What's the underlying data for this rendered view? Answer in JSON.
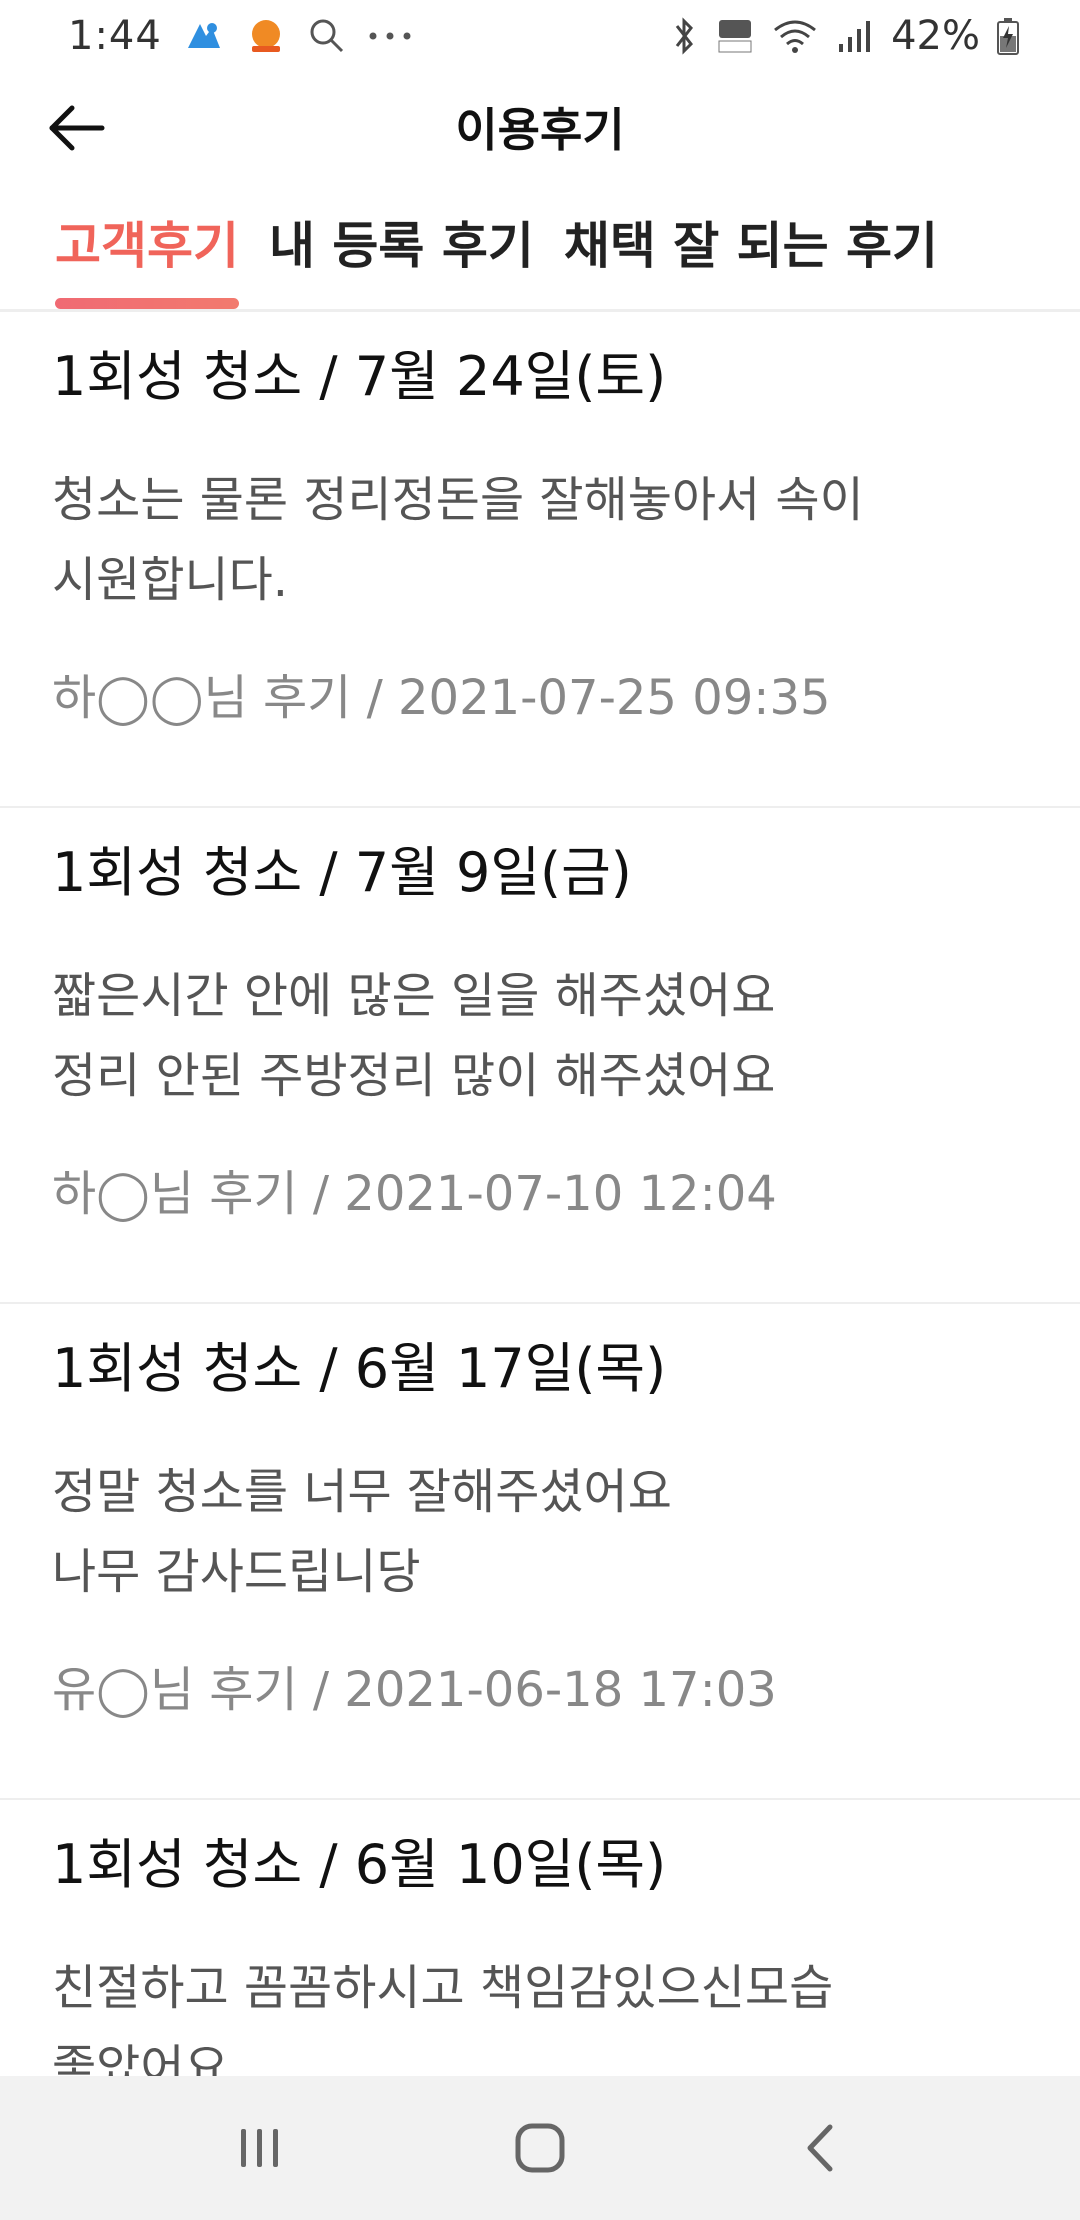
{
  "status_bar": {
    "time": "1:44",
    "battery_percent": "42%"
  },
  "app_bar": {
    "title": "이용후기"
  },
  "tabs": [
    {
      "label": "고객후기",
      "active": true
    },
    {
      "label": "내 등록 후기",
      "active": false
    },
    {
      "label": "채택 잘 되는 후기",
      "active": false
    }
  ],
  "reviews": [
    {
      "title": "1회성 청소 / 7월 24일(토)",
      "body": "청소는 물론 정리정돈을 잘해놓아서 속이\n시원합니다.",
      "meta": "하◯◯님 후기 / 2021-07-25 09:35"
    },
    {
      "title": "1회성 청소 / 7월 9일(금)",
      "body": "짧은시간 안에 많은 일을 해주셨어요\n정리 안된 주방정리 많이 해주셨어요",
      "meta": "하◯님 후기 / 2021-07-10 12:04"
    },
    {
      "title": "1회성 청소 / 6월 17일(목)",
      "body": "정말 청소를 너무 잘해주셨어요\n나무 감사드립니당",
      "meta": "유◯님 후기 / 2021-06-18 17:03"
    },
    {
      "title": "1회성 청소 / 6월 10일(목)",
      "body": "친절하고 꼼꼼하시고 책임감있으신모습\n좋았어요",
      "meta": ""
    }
  ],
  "colors": {
    "accent": "#f0645a",
    "nav_background": "#f2f2f2"
  },
  "icons": {
    "back": "arrow-left-icon",
    "recent_apps": "recent-apps-icon",
    "home": "home-icon",
    "nav_back": "chevron-left-icon"
  }
}
